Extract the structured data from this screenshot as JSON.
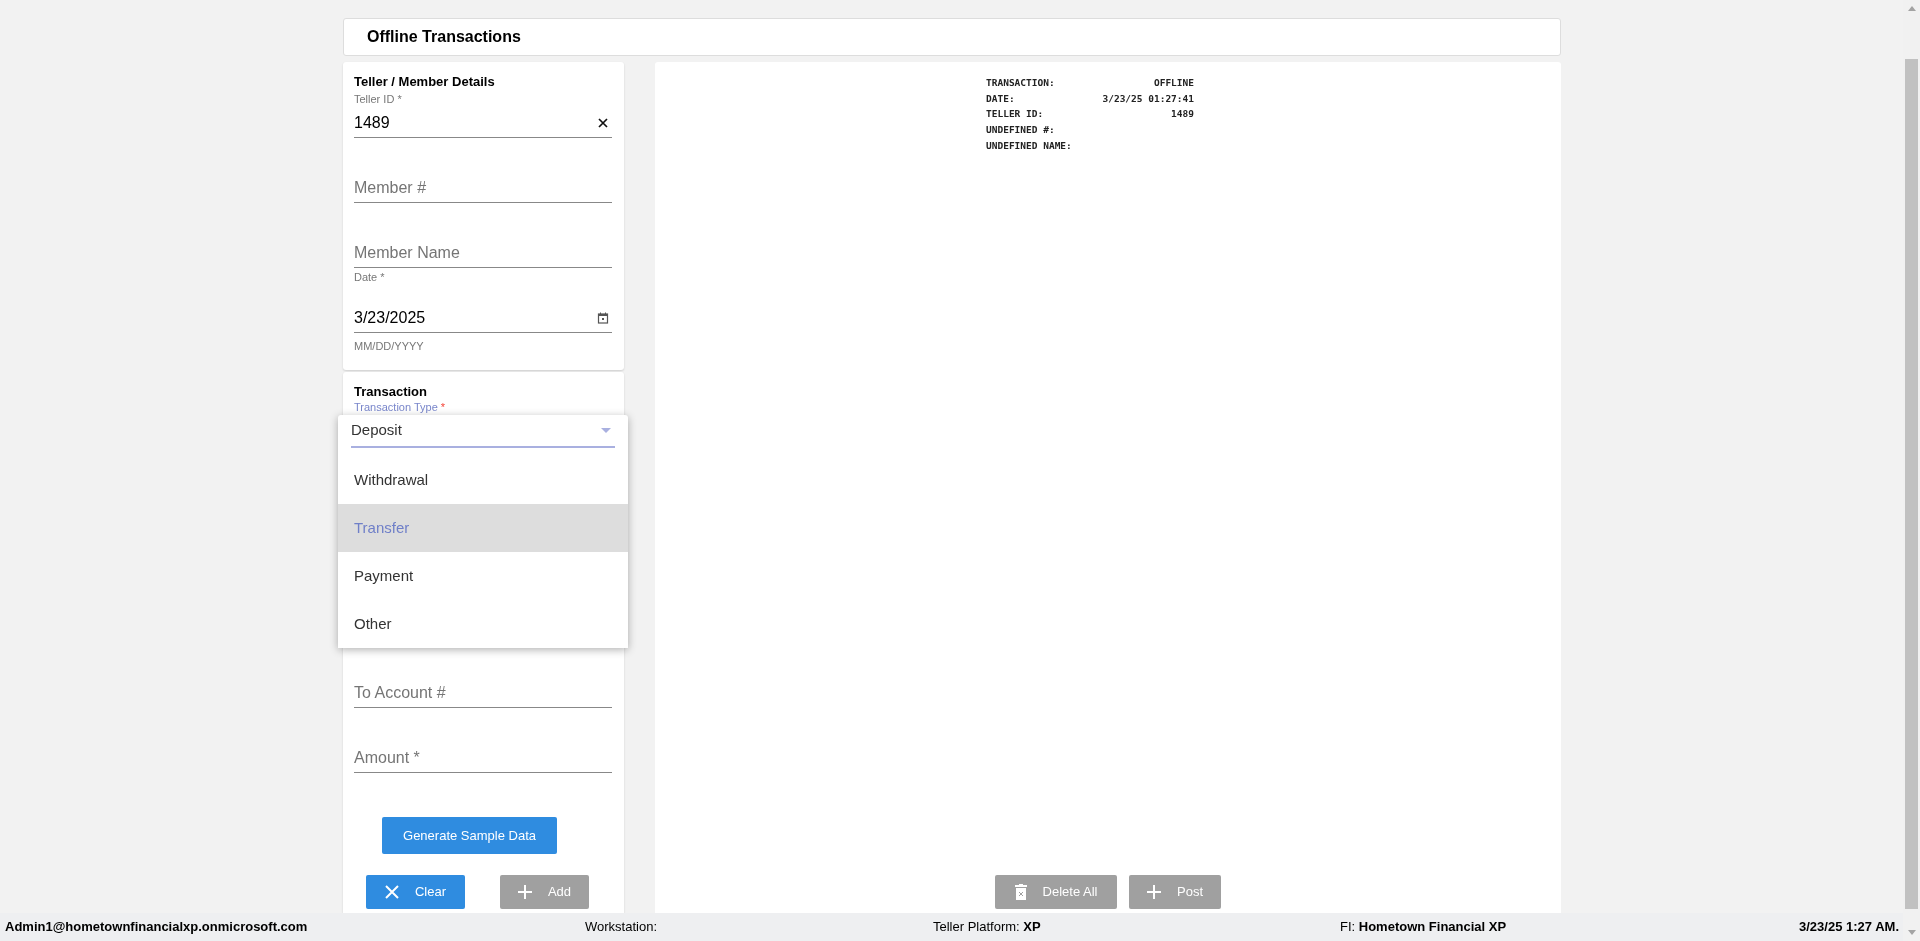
{
  "header": {
    "title": "Offline Transactions"
  },
  "teller_details": {
    "title": "Teller / Member Details",
    "fields": [
      {
        "kind": "value",
        "label": "Teller ID *",
        "value": "1489",
        "clearable": true
      },
      {
        "kind": "empty",
        "placeholder": "Member #"
      },
      {
        "kind": "empty",
        "placeholder": "Member Name"
      },
      {
        "kind": "date",
        "label": "Date *",
        "value": "3/23/2025",
        "helper": "MM/DD/YYYY"
      }
    ]
  },
  "transaction": {
    "title": "Transaction",
    "type_field": {
      "label": "Transaction Type",
      "mark": "*",
      "options": [
        {
          "label": "Deposit",
          "selected": false
        },
        {
          "label": "Withdrawal",
          "selected": false
        },
        {
          "label": "Transfer",
          "selected": true
        },
        {
          "label": "Payment",
          "selected": false
        },
        {
          "label": "Other",
          "selected": false
        }
      ]
    },
    "fields": [
      {
        "kind": "empty",
        "placeholder": "To Account #"
      },
      {
        "kind": "empty",
        "placeholder": "Amount *"
      }
    ],
    "sample_button": "Generate Sample Data",
    "buttons": [
      {
        "kind": "clear",
        "label": "Clear",
        "disabled": false
      },
      {
        "kind": "add",
        "label": "Add",
        "disabled": true
      }
    ]
  },
  "receipt": {
    "lines": [
      {
        "label": "TRANSACTION:",
        "value": "OFFLINE"
      },
      {
        "label": "DATE:",
        "value": "3/23/25 01:27:41"
      },
      {
        "label": "TELLER ID:",
        "value": "1489"
      },
      {
        "label": "UNDEFINED #:"
      },
      {
        "label": "UNDEFINED NAME:"
      }
    ],
    "buttons": [
      {
        "kind": "delete",
        "label": "Delete All",
        "disabled": true
      },
      {
        "kind": "post",
        "label": "Post",
        "disabled": true
      }
    ]
  },
  "status_bar": {
    "user": "Admin1@hometownfinancialxp.onmicrosoft.com",
    "workstation_label": "Workstation:",
    "platform_label": "Teller Platform:",
    "platform": "XP",
    "fi_label": "FI:",
    "fi": "Hometown Financial XP",
    "datetime": "3/23/25 1:27 AM."
  }
}
